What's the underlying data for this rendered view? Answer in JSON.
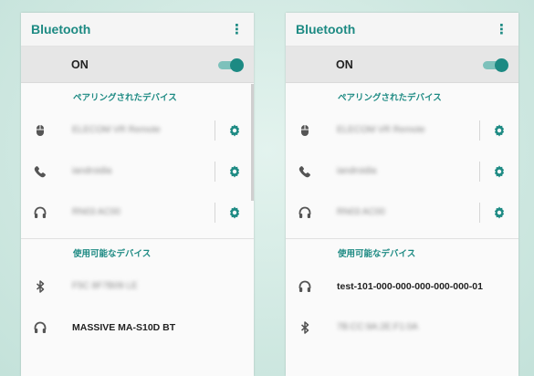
{
  "left": {
    "title": "Bluetooth",
    "menu_glyph": "⋮",
    "toggle_label": "ON",
    "paired_header": "ペアリングされたデバイス",
    "paired": [
      {
        "icon": "mouse-icon",
        "name": "ELECOM VR Remote"
      },
      {
        "icon": "phone-icon",
        "name": "iandroidia"
      },
      {
        "icon": "headset-icon",
        "name": "RN03 AC00"
      }
    ],
    "available_header": "使用可能なデバイス",
    "available": [
      {
        "icon": "bluetooth-icon",
        "name": "F5C 8F7B09 LE"
      },
      {
        "icon": "headset-icon",
        "name": "MASSIVE MA-S10D BT"
      }
    ]
  },
  "right": {
    "title": "Bluetooth",
    "menu_glyph": "⋮",
    "toggle_label": "ON",
    "paired_header": "ペアリングされたデバイス",
    "paired": [
      {
        "icon": "mouse-icon",
        "name": "ELECOM VR Remote"
      },
      {
        "icon": "phone-icon",
        "name": "iandroidia"
      },
      {
        "icon": "headset-icon",
        "name": "RN03 AC00"
      }
    ],
    "available_header": "使用可能なデバイス",
    "available": [
      {
        "icon": "headset-icon",
        "name": "test-101-000-000-000-000-000-01"
      },
      {
        "icon": "bluetooth-icon",
        "name": "7B:CC:9A:2E:F1:0A"
      }
    ]
  },
  "colors": {
    "accent": "#1d8a83",
    "toggle_track": "#7dc1bb",
    "background": "#cfe8e1"
  }
}
